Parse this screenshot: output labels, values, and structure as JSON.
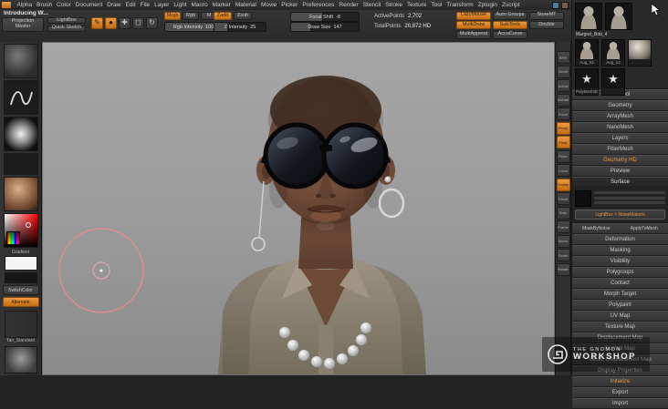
{
  "menubar": {
    "menus": [
      "Alpha",
      "Brush",
      "Color",
      "Document",
      "Draw",
      "Edit",
      "File",
      "Layer",
      "Light",
      "Macro",
      "Marker",
      "Material",
      "Movie",
      "Picker",
      "Preferences",
      "Render",
      "Stencil",
      "Stroke",
      "Texture",
      "Tool",
      "Transform",
      "Zplugin",
      "Zscript"
    ]
  },
  "toolbar": {
    "doc_title": "Introducing W...",
    "projection_master": "Projection Master",
    "lightbox": "LightBox",
    "quick_sketch": "Quick Sketch",
    "mode_buttons": [
      {
        "label": "✎",
        "active": true
      },
      {
        "label": "●",
        "active": true
      },
      {
        "label": "✚",
        "active": false
      },
      {
        "label": "◻",
        "active": false
      },
      {
        "label": "↻",
        "active": false
      }
    ],
    "paint_modes": [
      {
        "label": "Mrgb",
        "active": true
      },
      {
        "label": "Rgb",
        "active": false
      },
      {
        "label": "M",
        "active": false
      }
    ],
    "rgb_intensity": {
      "label": "Rgb Intensity",
      "value": "100",
      "fill": 100
    },
    "sculpt_modes": [
      {
        "label": "Zadd",
        "active": true
      },
      {
        "label": "Zsub",
        "active": false
      }
    ],
    "z_intensity": {
      "label": "Z Intensity",
      "value": "25",
      "fill": 25
    },
    "focal_shift": {
      "label": "Focal Shift",
      "value": "-8",
      "fill": 46
    },
    "draw_size": {
      "label": "Draw Size",
      "value": "147",
      "fill": 29
    },
    "active_points": {
      "label": "ActivePoints",
      "value": "2,702"
    },
    "total_points": {
      "label": "TotalPoints",
      "value": "20,872 HD"
    },
    "right_row1": [
      {
        "label": "LazyMouse",
        "active": true
      },
      {
        "label": "Auto Groups",
        "active": false
      },
      {
        "label": "StoreMT",
        "active": false
      }
    ],
    "right_row2": [
      {
        "label": "MultiDraw",
        "active": true
      },
      {
        "label": "SubTools",
        "active": true
      },
      {
        "label": "Double",
        "active": false
      }
    ],
    "right_row3": [
      {
        "label": "MultiAppend",
        "active": false
      },
      {
        "label": "AccuCurve",
        "active": false
      }
    ]
  },
  "left_tray": {
    "gradient_label": "Gradient",
    "switch_color": "SwitchColor",
    "alternate": "Alternate",
    "material_name": "Tan_Standard"
  },
  "strip": {
    "buttons": [
      {
        "label": "BPR",
        "active": false
      },
      {
        "label": "Scroll",
        "active": false
      },
      {
        "label": "Actual",
        "active": false
      },
      {
        "label": "AAHalf",
        "active": false
      },
      {
        "label": "Zoom",
        "active": false
      },
      {
        "label": "Persp",
        "active": true
      },
      {
        "label": "Floor",
        "active": true
      },
      {
        "label": "Ruler",
        "active": false
      },
      {
        "label": "Local",
        "active": false
      },
      {
        "label": "Transp",
        "active": true
      },
      {
        "label": "Ghost",
        "active": false
      },
      {
        "label": "Solo",
        "active": false
      },
      {
        "label": "Frame",
        "active": false
      },
      {
        "label": "Move",
        "active": false
      },
      {
        "label": "Scale",
        "active": false
      },
      {
        "label": "Rotate",
        "active": false
      }
    ]
  },
  "tool_panel": {
    "tool_name": "Margret_Bob_4",
    "thumbs1": [
      {
        "type": "bust",
        "label": ""
      },
      {
        "type": "bust",
        "label": ""
      }
    ],
    "thumbs2": [
      {
        "type": "bust",
        "label": "Aug_02"
      },
      {
        "type": "bust",
        "label": "Aug_12"
      },
      {
        "type": "sphere",
        "label": ""
      }
    ],
    "thumbs3": [
      {
        "type": "star",
        "label": "PolyMesh3D"
      },
      {
        "type": "star",
        "label": ""
      }
    ],
    "sections_top": [
      {
        "label": "SubTool"
      },
      {
        "label": "Geometry"
      },
      {
        "label": "ArrayMesh"
      },
      {
        "label": "NanoMesh"
      },
      {
        "label": "Layers"
      },
      {
        "label": "FiberMesh"
      },
      {
        "label": "Geometry HD",
        "accent": true
      },
      {
        "label": "Preview"
      }
    ],
    "surface": {
      "title": "Surface",
      "lightbox_button": "LightBox > NoiseMakers",
      "bottom_buttons": [
        {
          "label": "MaskByNoise"
        },
        {
          "label": "ApplyToMesh"
        }
      ]
    },
    "sections_bottom": [
      {
        "label": "Deformation"
      },
      {
        "label": "Masking"
      },
      {
        "label": "Visibility"
      },
      {
        "label": "Polygroups"
      },
      {
        "label": "Contact"
      },
      {
        "label": "Morph Target"
      },
      {
        "label": "Polypaint"
      },
      {
        "label": "UV Map"
      },
      {
        "label": "Texture Map"
      },
      {
        "label": "Displacement Map"
      },
      {
        "label": "Normal Map"
      },
      {
        "label": "Vector Displacement Map"
      },
      {
        "label": "Display Properties"
      },
      {
        "label": "Initialize",
        "accent": true
      },
      {
        "label": "Export"
      },
      {
        "label": "Import"
      }
    ]
  },
  "watermark": {
    "line1": "THE GNOMON",
    "line2": "WORKSHOP"
  },
  "colors": {
    "accent": "#d97a1e",
    "canvas_gray": "#9a9a9a"
  }
}
